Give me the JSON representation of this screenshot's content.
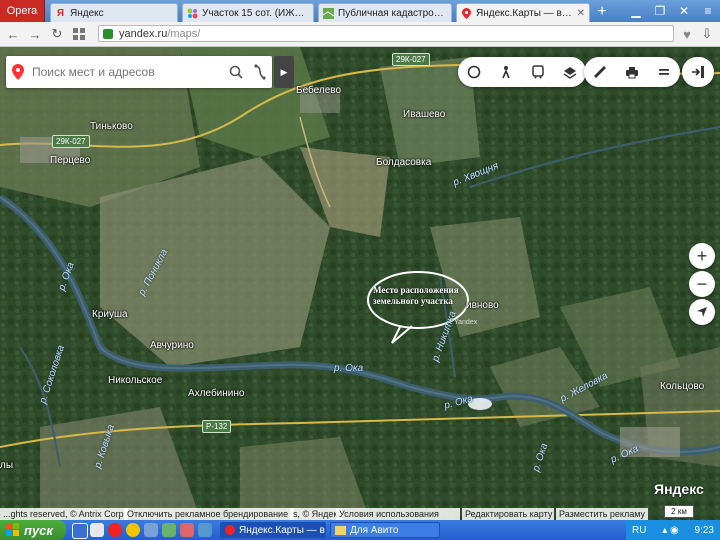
{
  "browser": {
    "menu_label": "Opera",
    "tabs": [
      {
        "label": "Яндекс",
        "icon": "yandex-icon",
        "active": false
      },
      {
        "label": "Участок 15 сот. (ИЖС) — ку",
        "icon": "avito-icon",
        "active": false
      },
      {
        "label": "Публичная кадастровая ка",
        "icon": "map-icon",
        "active": false
      },
      {
        "label": "Яндекс.Карты — выбирайте",
        "icon": "yandex-maps-pin-icon",
        "active": true
      }
    ],
    "address": {
      "host": "yandex.ru",
      "path": "/maps/"
    }
  },
  "map": {
    "search_placeholder": "Поиск мест и адресов",
    "villages": [
      "Бебелево",
      "Ивашево",
      "Тиньково",
      "Перцево",
      "Болдасовка",
      "Криуша",
      "Авчурино",
      "Никольское",
      "Ахлебинино",
      "Кольцово",
      "ивново",
      "лы"
    ],
    "rivers": [
      "р. Хвощня",
      "р. Ока",
      "р. Поникла",
      "р. Никитка",
      "р. Ока",
      "р. Ока",
      "р. Желовка",
      "р. Ока",
      "р. Соколовка",
      "р. Ока",
      "р. Ковыка"
    ],
    "road_shields": [
      "29К-027",
      "29К-027",
      "Р-132"
    ],
    "annotation": "Место расположения земельного участка",
    "pin_label": "Yandex",
    "brand": "Яндекс",
    "scale": "2 км",
    "footer": {
      "copyright": "...ghts reserved, © Antrix Corp",
      "disable_branding": "Отключить рекламное брендирование",
      "terms_partial": "s, © Яндекс",
      "terms": "Условия использования",
      "edit": "Редактировать карту",
      "ads": "Разместить рекламу"
    }
  },
  "taskbar": {
    "start": "пуск",
    "windows": [
      "Яндекс.Карты — выб...",
      "Для Авито"
    ],
    "lang": "RU",
    "time": "9:23"
  }
}
